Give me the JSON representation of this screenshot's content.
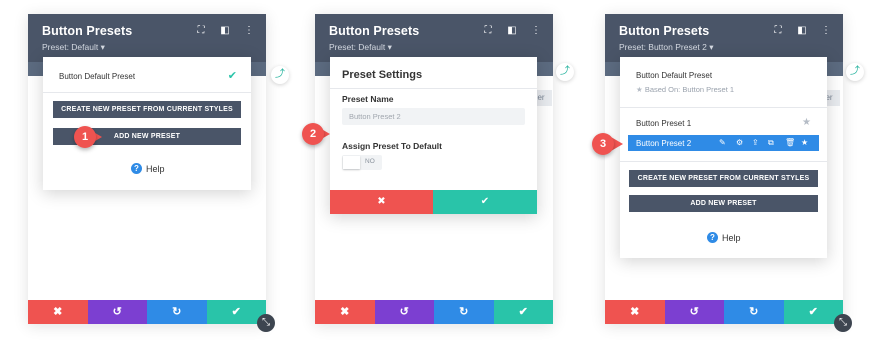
{
  "panels": [
    {
      "title": "Button Presets",
      "preset_label": "Preset: Default ▾",
      "popup": {
        "default_preset": "Button Default Preset",
        "create_btn": "CREATE NEW PRESET FROM CURRENT STYLES",
        "add_btn": "ADD NEW PRESET",
        "help": "Help"
      },
      "step": "1"
    },
    {
      "title": "Button Presets",
      "preset_label": "Preset: Default ▾",
      "settings": {
        "heading": "Preset Settings",
        "name_label": "Preset Name",
        "name_placeholder": "Button Preset 2",
        "assign_label": "Assign Preset To Default",
        "toggle_value": "NO"
      },
      "step": "2"
    },
    {
      "title": "Button Presets",
      "preset_label": "Preset: Button Preset 2 ▾",
      "popup": {
        "default_preset": "Button Default Preset",
        "based_on": "Based On: Button Preset 1",
        "preset1": "Button Preset 1",
        "preset2": "Button Preset 2",
        "create_btn": "CREATE NEW PRESET FROM CURRENT STYLES",
        "add_btn": "ADD NEW PRESET",
        "help": "Help"
      },
      "step": "3"
    }
  ],
  "strip_tab": "er",
  "footer_icons": [
    "close-icon",
    "undo-icon",
    "redo-icon",
    "check-icon"
  ],
  "colors": {
    "header": "#4a5568",
    "red": "#ef5350",
    "purple": "#7c3fd1",
    "blue": "#2f8be6",
    "green": "#29c4a9"
  }
}
